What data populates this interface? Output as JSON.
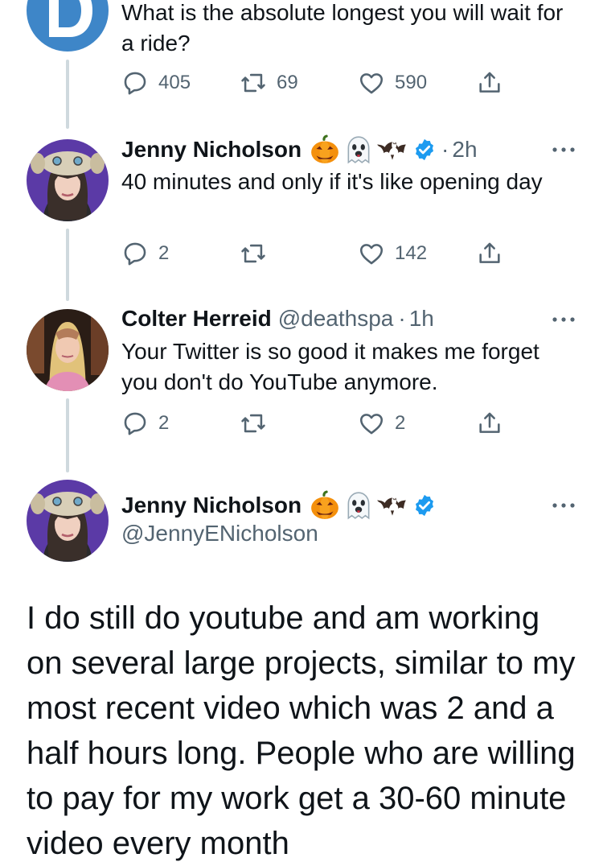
{
  "colors": {
    "verified": "#1d9bf0",
    "secondary_text": "#536471",
    "thread_line": "#cfd9de",
    "avatar_bg": "#5b3aa6"
  },
  "top_tweet": {
    "avatar_icon": "newspaper-logo-icon",
    "text": "What is the absolute longest you will wait for a ride?",
    "replies": "405",
    "retweets": "69",
    "likes": "590"
  },
  "reply1": {
    "name": "Jenny Nicholson",
    "emojis": [
      "jack-o-lantern-icon",
      "ghost-icon",
      "bat-icon"
    ],
    "time": "2h",
    "text": "40 minutes and only if it's like opening day",
    "replies": "2",
    "retweets": "",
    "likes": "142"
  },
  "reply2": {
    "name": "Colter Herreid",
    "handle": "@deathspa",
    "time": "1h",
    "text": "Your Twitter is so good it makes me forget you don't do YouTube anymore.",
    "replies": "2",
    "retweets": "",
    "likes": "2"
  },
  "main_tweet": {
    "name": "Jenny Nicholson",
    "emojis": [
      "jack-o-lantern-icon",
      "ghost-icon",
      "bat-icon"
    ],
    "handle": "@JennyENicholson",
    "text": "I do still do youtube and am working on several large projects, similar to my most recent video which was 2 and a half hours long. People who are willing to pay for my work get a 30-60 minute video every month"
  }
}
